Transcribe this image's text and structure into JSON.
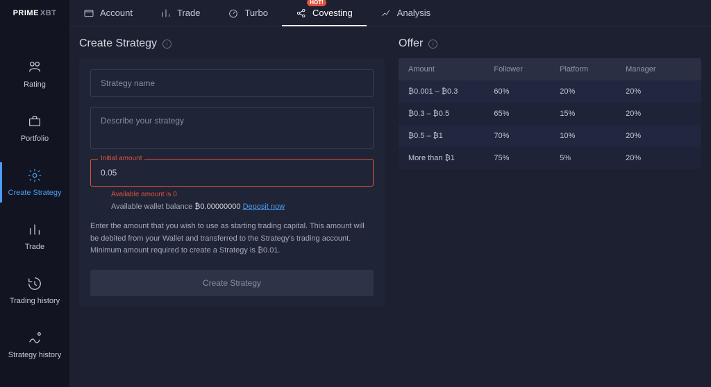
{
  "brand": {
    "left": "PRIME",
    "right": "XBT"
  },
  "topnav": {
    "account": "Account",
    "trade": "Trade",
    "turbo": "Turbo",
    "covesting": "Covesting",
    "analysis": "Analysis",
    "hot": "HOT!"
  },
  "sidebar": {
    "items": [
      {
        "label": "Rating"
      },
      {
        "label": "Portfolio"
      },
      {
        "label": "Create Strategy"
      },
      {
        "label": "Trade"
      },
      {
        "label": "Trading history"
      },
      {
        "label": "Strategy history"
      }
    ]
  },
  "create": {
    "title": "Create Strategy",
    "name_placeholder": "Strategy name",
    "desc_placeholder": "Describe your strategy",
    "initial_label": "Initial amount",
    "initial_value": "0.05",
    "error_msg": "Available amount is 0",
    "balance_prefix": "Available wallet balance ",
    "balance_value": "₿0.00000000",
    "deposit_link": "Deposit now",
    "help": "Enter the amount that you wish to use as starting trading capital. This amount will be debited from your Wallet and transferred to the Strategy's trading account. Minimum amount required to create a Strategy is ₿0.01.",
    "button": "Create Strategy"
  },
  "offer": {
    "title": "Offer",
    "columns": {
      "amount": "Amount",
      "follower": "Follower",
      "platform": "Platform",
      "manager": "Manager"
    },
    "rows": [
      {
        "amount": "₿0.001 – ₿0.3",
        "follower": "60%",
        "platform": "20%",
        "manager": "20%"
      },
      {
        "amount": "₿0.3 – ₿0.5",
        "follower": "65%",
        "platform": "15%",
        "manager": "20%"
      },
      {
        "amount": "₿0.5 – ₿1",
        "follower": "70%",
        "platform": "10%",
        "manager": "20%"
      },
      {
        "amount": "More than ₿1",
        "follower": "75%",
        "platform": "5%",
        "manager": "20%"
      }
    ]
  }
}
